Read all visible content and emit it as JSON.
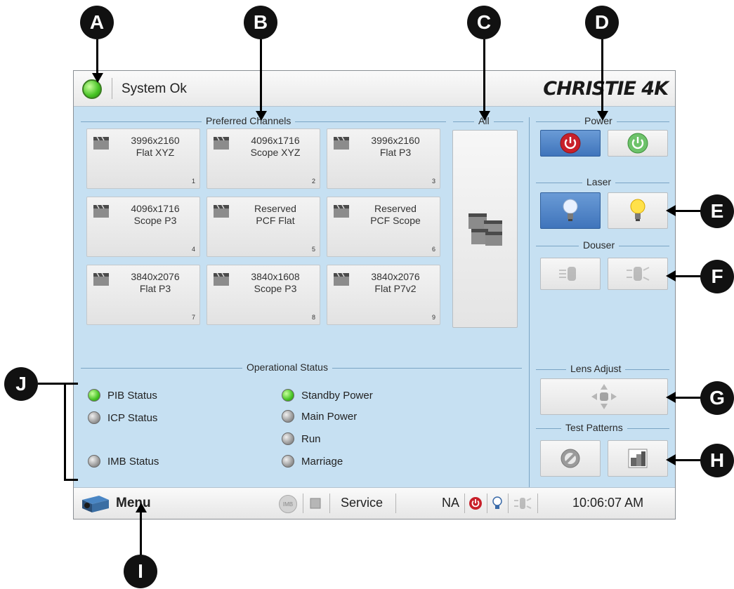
{
  "callouts": [
    "A",
    "B",
    "C",
    "D",
    "E",
    "F",
    "G",
    "H",
    "I",
    "J"
  ],
  "status": {
    "text": "System Ok",
    "color": "#45c223"
  },
  "brand": "CHRISTIE 4K",
  "groups": {
    "preferred": "Preferred Channels",
    "all": "All",
    "power": "Power",
    "laser": "Laser",
    "douser": "Douser",
    "operational": "Operational Status",
    "lens": "Lens Adjust",
    "test": "Test Patterns"
  },
  "channels": [
    {
      "line1": "3996x2160",
      "line2": "Flat XYZ",
      "num": "1"
    },
    {
      "line1": "4096x1716",
      "line2": "Scope XYZ",
      "num": "2"
    },
    {
      "line1": "3996x2160",
      "line2": "Flat P3",
      "num": "3"
    },
    {
      "line1": "4096x1716",
      "line2": "Scope P3",
      "num": "4"
    },
    {
      "line1": "Reserved",
      "line2": "PCF Flat",
      "num": "5"
    },
    {
      "line1": "Reserved",
      "line2": "PCF Scope",
      "num": "6"
    },
    {
      "line1": "3840x2076",
      "line2": "Flat P3",
      "num": "7"
    },
    {
      "line1": "3840x1608",
      "line2": "Scope P3",
      "num": "8"
    },
    {
      "line1": "3840x2076",
      "line2": "Flat P7v2",
      "num": "9"
    }
  ],
  "op_status": {
    "left": [
      {
        "label": "PIB Status",
        "state": "green"
      },
      {
        "label": "ICP Status",
        "state": "grey"
      },
      {
        "label": "IMB Status",
        "state": "grey"
      }
    ],
    "right": [
      {
        "label": "Standby Power",
        "state": "green"
      },
      {
        "label": "Main Power",
        "state": "grey"
      },
      {
        "label": "Run",
        "state": "grey"
      },
      {
        "label": "Marriage",
        "state": "grey"
      }
    ]
  },
  "bottom": {
    "menu": "Menu",
    "imb": "IMB",
    "service": "Service",
    "na": "NA",
    "time": "10:06:07 AM"
  },
  "colors": {
    "power_red": "#c8202a",
    "power_green": "#4caf50",
    "selected": "#3f74bb",
    "panel": "#c6e0f2"
  },
  "icons": [
    "power-off-icon",
    "power-on-icon",
    "bulb-off-icon",
    "bulb-on-icon",
    "douser-closed-icon",
    "douser-open-icon",
    "lens-arrows-icon",
    "no-pattern-icon",
    "test-pattern-icon",
    "projector-icon",
    "clapperboard-icon"
  ]
}
